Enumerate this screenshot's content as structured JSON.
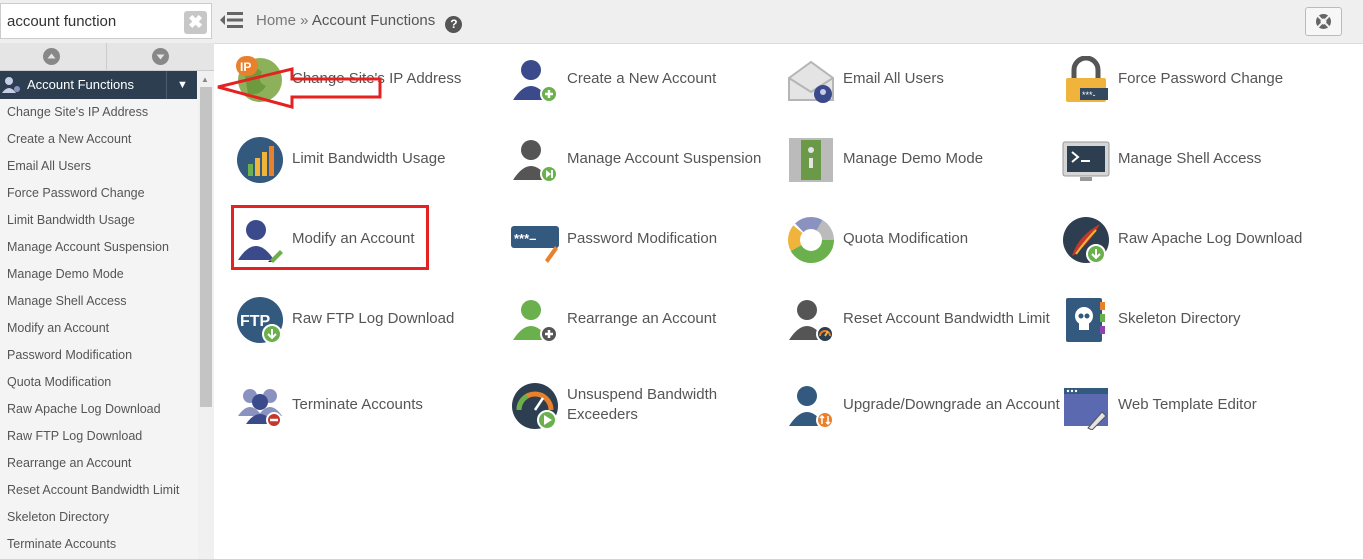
{
  "search": {
    "value": "account function",
    "clear_label": "✖"
  },
  "breadcrumb": {
    "home": "Home »",
    "current": "Account Functions",
    "help": "?"
  },
  "sidebar": {
    "category": "Account Functions",
    "collapse": "▼",
    "scroll_up": "▲",
    "items": [
      "Change Site's IP Address",
      "Create a New Account",
      "Email All Users",
      "Force Password Change",
      "Limit Bandwidth Usage",
      "Manage Account Suspension",
      "Manage Demo Mode",
      "Manage Shell Access",
      "Modify an Account",
      "Password Modification",
      "Quota Modification",
      "Raw Apache Log Download",
      "Raw FTP Log Download",
      "Rearrange an Account",
      "Reset Account Bandwidth Limit",
      "Skeleton Directory",
      "Terminate Accounts"
    ]
  },
  "tiles": [
    {
      "label": "Change Site's IP Address",
      "icon": "ip-address-icon"
    },
    {
      "label": "Create a New Account",
      "icon": "create-account-icon"
    },
    {
      "label": "Email All Users",
      "icon": "email-icon"
    },
    {
      "label": "Force Password Change",
      "icon": "padlock-icon"
    },
    {
      "label": "Limit Bandwidth Usage",
      "icon": "bandwidth-chart-icon"
    },
    {
      "label": "Manage Account Suspension",
      "icon": "suspension-icon"
    },
    {
      "label": "Manage Demo Mode",
      "icon": "demo-mode-icon"
    },
    {
      "label": "Manage Shell Access",
      "icon": "terminal-icon"
    },
    {
      "label": "Modify an Account",
      "icon": "modify-account-icon"
    },
    {
      "label": "Password Modification",
      "icon": "password-field-icon"
    },
    {
      "label": "Quota Modification",
      "icon": "quota-pie-icon"
    },
    {
      "label": "Raw Apache Log Download",
      "icon": "apache-feather-icon"
    },
    {
      "label": "Raw FTP Log Download",
      "icon": "ftp-download-icon"
    },
    {
      "label": "Rearrange an Account",
      "icon": "rearrange-account-icon"
    },
    {
      "label": "Reset Account Bandwidth Limit",
      "icon": "reset-bandwidth-icon"
    },
    {
      "label": "Skeleton Directory",
      "icon": "skeleton-directory-icon"
    },
    {
      "label": "Terminate Accounts",
      "icon": "terminate-accounts-icon"
    },
    {
      "label": "Unsuspend Bandwidth Exceeders",
      "icon": "gauge-play-icon"
    },
    {
      "label": "Upgrade/Downgrade an Account",
      "icon": "upgrade-account-icon"
    },
    {
      "label": "Web Template Editor",
      "icon": "template-editor-icon"
    }
  ],
  "colors": {
    "sidebar_header": "#2c3e50",
    "highlight": "#e52222",
    "user_blue": "#3a4a8a",
    "user_gray": "#555555",
    "user_green": "#6ab04c"
  }
}
